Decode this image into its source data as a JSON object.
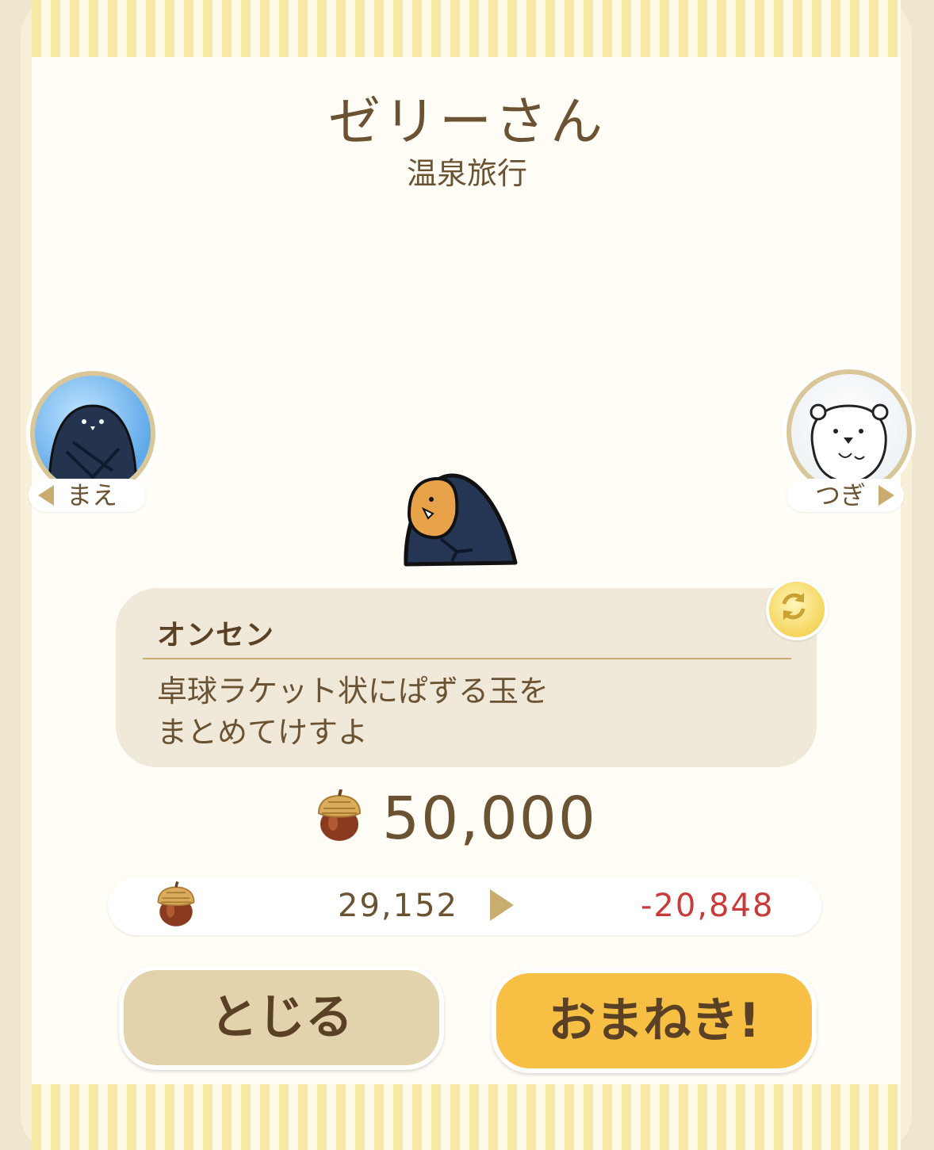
{
  "header": {
    "name": "ゼリーさん",
    "subtitle": "温泉旅行"
  },
  "navigation": {
    "prev_label": "まえ",
    "next_label": "つぎ"
  },
  "card": {
    "title": "オンセン",
    "description_line1": "卓球ラケット状にぱずる玉を",
    "description_line2": "まとめてけすよ"
  },
  "price": {
    "cost": "50,000"
  },
  "balance": {
    "current": "29,152",
    "after": "-20,848"
  },
  "buttons": {
    "close": "とじる",
    "invite": "おまねき!"
  },
  "icons": {
    "currency": "acorn-icon",
    "refresh": "refresh-icon",
    "prev": "triangle-left-icon",
    "next": "triangle-right-icon"
  },
  "colors": {
    "text": "#6b5233",
    "negative": "#c93a3a",
    "invite_button": "#f7bf43",
    "close_button": "#e3d3ad",
    "accent_gold": "#c9ac70"
  }
}
